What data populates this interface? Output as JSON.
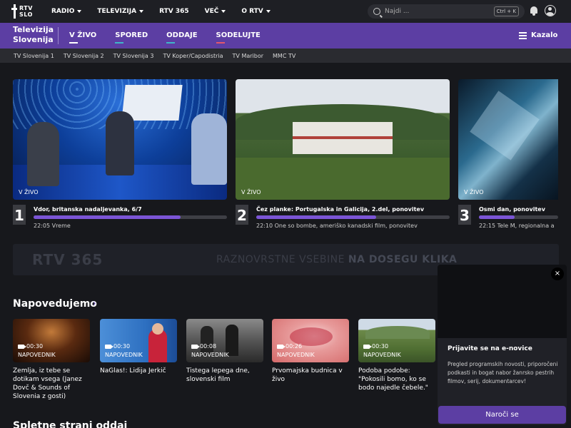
{
  "topbar": {
    "logo_line1": "RTV",
    "logo_line2": "SLO",
    "nav": [
      {
        "label": "RADIO",
        "dropdown": true
      },
      {
        "label": "TELEVIZIJA",
        "dropdown": true
      },
      {
        "label": "RTV 365",
        "dropdown": false
      },
      {
        "label": "VEČ",
        "dropdown": true
      },
      {
        "label": "O RTV",
        "dropdown": true
      }
    ],
    "search_placeholder": "Najdi ...",
    "search_shortcut": "Ctrl + K"
  },
  "purplebar": {
    "brand_line1": "Televizija",
    "brand_line2": "Slovenija",
    "nav": [
      {
        "label": "V ŽIVO",
        "underline": "#ffffff"
      },
      {
        "label": "SPORED",
        "underline": "#3fb6c9"
      },
      {
        "label": "ODDAJE",
        "underline": "#3fb6c9"
      },
      {
        "label": "SODELUJTE",
        "underline": "#e2576d"
      }
    ],
    "kazalo": "Kazalo"
  },
  "channels": [
    "TV Slovenija 1",
    "TV Slovenija 2",
    "TV Slovenija 3",
    "TV Koper/Capodistria",
    "TV Maribor",
    "MMC TV"
  ],
  "live": [
    {
      "badge": "V ŽIVO",
      "number": "1",
      "title": "Vdor, britanska nadaljevanka, 6/7",
      "progress": 0.76,
      "next": "22:05 Vreme"
    },
    {
      "badge": "V ŽIVO",
      "number": "2",
      "title": "Čez planke: Portugalska in Galicija, 2.del, ponovitev",
      "progress": 0.62,
      "next": "22:10 One so bombe, ameriško kanadski film, ponovitev"
    },
    {
      "badge": "V ŽIVO",
      "number": "3",
      "title": "Osmi dan, ponovitev",
      "progress": 0.45,
      "next": "22:15 Tele M, regionalna a"
    }
  ],
  "promo": {
    "logo": "RTV 365",
    "text_plain": "RAZNOVRSTNE VSEBINE ",
    "text_bold": "NA DOSEGU KLIKA"
  },
  "section_title": "Napovedujemo",
  "section_arrow": "›",
  "previews": [
    {
      "duration": "00:30",
      "kind": "NAPOVEDNIK",
      "title": "Zemlja, iz tebe se dotikam vsega (Janez Dovč & Sounds of Slovenia z gosti)"
    },
    {
      "duration": "00:30",
      "kind": "NAPOVEDNIK",
      "title": "NaGlas!: Lidija Jerkič"
    },
    {
      "duration": "00:08",
      "kind": "NAPOVEDNIK",
      "title": "Tistega lepega dne, slovenski film"
    },
    {
      "duration": "00:26",
      "kind": "NAPOVEDNIK",
      "title": "Prvomajska budnica v živo"
    },
    {
      "duration": "00:30",
      "kind": "NAPOVEDNIK",
      "title": "Podoba podobe: \"Pokosili bomo, ko se bodo najedle čebele.\""
    }
  ],
  "newsletter": {
    "close": "×",
    "heading": "Prijavite se na e-novice",
    "text": "Pregled programskih novosti, priporočeni podkasti in bogat nabor žanrsko pestrih filmov, serij, dokumentarcev!",
    "button": "Naroči se"
  },
  "section2_title": "Spletne strani oddaj"
}
